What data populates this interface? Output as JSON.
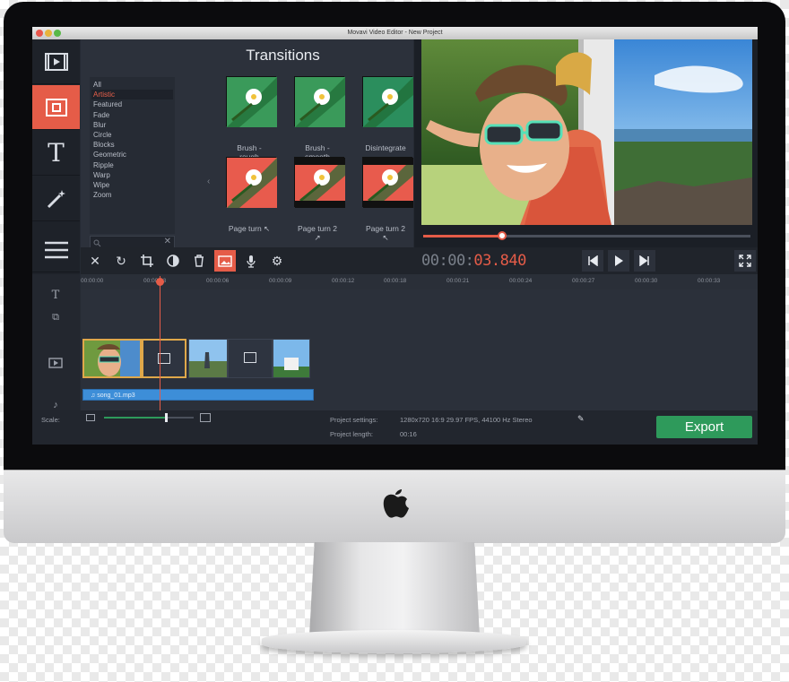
{
  "window": {
    "title": "Movavi Video Editor - New Project"
  },
  "sidebar": {
    "items": [
      {
        "name": "import",
        "icon": "film-icon"
      },
      {
        "name": "transitions",
        "icon": "transitions-icon",
        "active": true
      },
      {
        "name": "titles",
        "icon": "text-icon",
        "glyph": "T"
      },
      {
        "name": "filters",
        "icon": "magic-wand-icon"
      },
      {
        "name": "more",
        "icon": "menu-icon"
      }
    ]
  },
  "transitions": {
    "title": "Transitions",
    "categories": [
      "All",
      "Artistic",
      "Featured",
      "Fade",
      "Blur",
      "Circle",
      "Blocks",
      "Geometric",
      "Ripple",
      "Warp",
      "Wipe",
      "Zoom"
    ],
    "selected_category": "Artistic",
    "items": [
      {
        "label": "Brush -\nrough"
      },
      {
        "label": "Brush -\nsmooth"
      },
      {
        "label": "Disintegrate"
      },
      {
        "label": "Page turn ↖"
      },
      {
        "label": "Page turn 2\n↗"
      },
      {
        "label": "Page turn 2\n↖"
      }
    ]
  },
  "player": {
    "timecode_dim": "00:00:",
    "timecode_hot": "03.840",
    "progress": 0.24
  },
  "ruler": {
    "ticks": [
      "00:00:00",
      "00:00:03",
      "00:00:06",
      "00:00:09",
      "00:00:12",
      "00:00:18",
      "00:00:21",
      "00:00:24",
      "00:00:27",
      "00:00:30",
      "00:00:33"
    ]
  },
  "audio": {
    "clip_name": "♫ song_01.mp3"
  },
  "footer": {
    "scale_label": "Scale:",
    "settings_label": "Project settings:",
    "settings_value": "1280x720 16:9 29.97 FPS, 44100 Hz Stereo",
    "length_label": "Project length:",
    "length_value": "00:16",
    "export_label": "Export"
  },
  "colors": {
    "accent": "#e55c48",
    "export": "#2e9a5b",
    "audio": "#3d8ed8"
  }
}
